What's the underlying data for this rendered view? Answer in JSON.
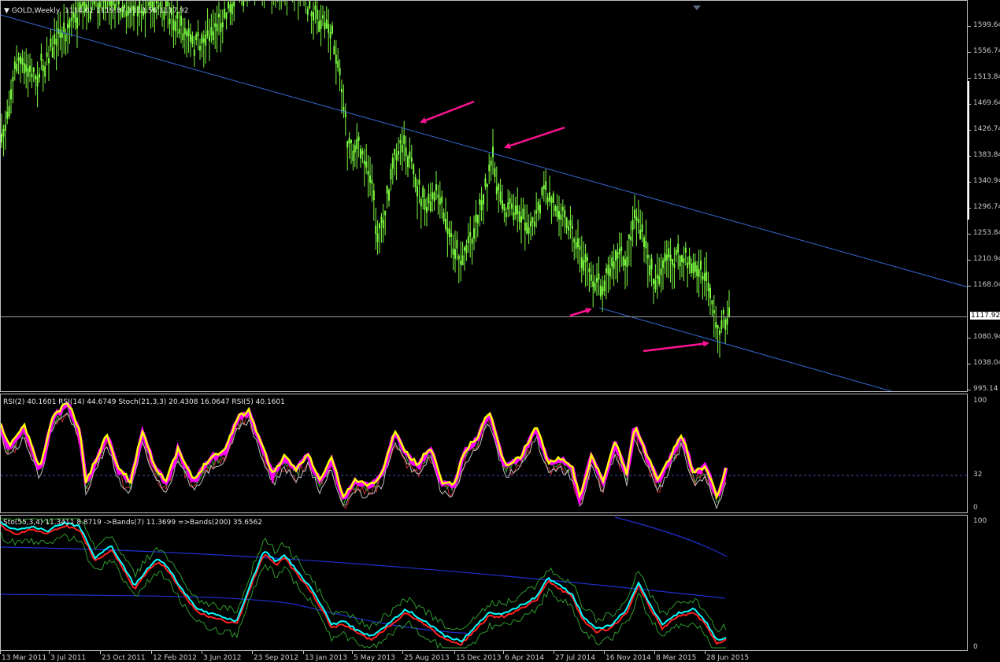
{
  "main": {
    "symbol_header": "GOLD,Weekly",
    "ohlc": "1114.01 1119.87 1113.56 1117.92",
    "price_labels": [
      "1599.64",
      "1556.74",
      "1513.84",
      "1469.64",
      "1426.74",
      "1383.84",
      "1340.94",
      "1296.74",
      "1253.84",
      "1210.94",
      "1168.04",
      "1080.94",
      "1038.04",
      "995.14"
    ],
    "current_price": "1117.92",
    "colors": {
      "candle": "#7cfc40",
      "trendline": "#3a6ad8",
      "arrow": "#ff1493",
      "price_line": "#9c9c9c"
    }
  },
  "rsi_pane": {
    "header": "RSI(2) 40.1601  RSI(14) 44.6749  Stoch(21,3,3) 20.4308 16.0647  RSI(5) 40.1601",
    "scale": [
      "100",
      "32",
      "0"
    ],
    "colors": {
      "rsi5": "#ffff00",
      "rsi2": "#ff00ff",
      "rsi14": "#c0c0c0",
      "stoch_main": "#40a040",
      "stoch_signal": "#c03030"
    }
  },
  "stoch_pane": {
    "header": "Sto(55,3,4) 11.3411 8.8719   ->Bands(7) 11.3699   =>Bands(200) 35.6562",
    "scale": [
      "100",
      "0"
    ],
    "colors": {
      "main": "#00ffff",
      "signal": "#ff2020",
      "bands7": "#2e9a2e",
      "bands200": "#2030d0"
    }
  },
  "dates": [
    "13 Mar 2011",
    "3 Jul 2011",
    "23 Oct 2011",
    "12 Feb 2012",
    "3 Jun 2012",
    "23 Sep 2012",
    "13 Jan 2013",
    "5 May 2013",
    "25 Aug 2013",
    "15 Dec 2013",
    "6 Apr 2014",
    "27 Jul 2014",
    "16 Nov 2014",
    "8 Mar 2015",
    "28 Jun 2015"
  ]
}
